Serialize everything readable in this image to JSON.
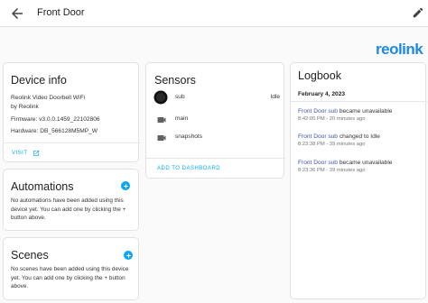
{
  "header": {
    "title": "Front Door"
  },
  "logo": {
    "text": "reolink",
    "color": "#1e88e5"
  },
  "device_info": {
    "title": "Device info",
    "model": "Reolink Video Doorbell WiFi",
    "manufacturer": "by Reolink",
    "firmware": "Firmware: v3.0.0.1459_22102806",
    "hardware": "Hardware: DB_566128M5MP_W",
    "visit_label": "VISIT"
  },
  "automations": {
    "title": "Automations",
    "text": "No automations have been added using this device yet. You can add one by clicking the + button above."
  },
  "scenes": {
    "title": "Scenes",
    "text": "No scenes have been added using this device yet. You can add one by clicking the + button above."
  },
  "sensors": {
    "title": "Sensors",
    "entities": [
      {
        "name": "sub",
        "state": "Idle",
        "icon": "camera-thumbnail"
      },
      {
        "name": "main",
        "state": "",
        "icon": "video-icon"
      },
      {
        "name": "snapshots",
        "state": "",
        "icon": "video-icon"
      }
    ],
    "add_to_dashboard_label": "ADD TO DASHBOARD"
  },
  "logbook": {
    "title": "Logbook",
    "date": "February 4, 2023",
    "entries": [
      {
        "entity": "Front Door sub",
        "message": " became unavailable",
        "time": "8:42:05 PM - 20 minutes ago"
      },
      {
        "entity": "Front Door sub",
        "message": " changed to Idle",
        "time": "8:23:38 PM - 39 minutes ago"
      },
      {
        "entity": "Front Door sub",
        "message": " became unavailable",
        "time": "8:23:36 PM - 39 minutes ago"
      }
    ]
  },
  "colors": {
    "accent": "#03a9f4",
    "link": "#3f51b5"
  }
}
